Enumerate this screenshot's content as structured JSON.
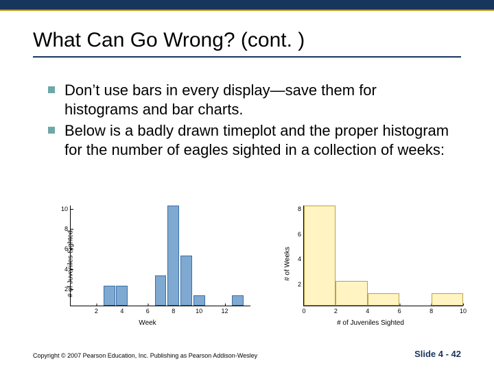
{
  "title": "What Can Go Wrong? (cont. )",
  "bullets": [
    "Don’t use bars in every display—save them for histograms and bar charts.",
    "Below is a badly drawn timeplot and the proper histogram for the number of eagles sighted in a collection of weeks:"
  ],
  "footer": {
    "copyright": "Copyright © 2007 Pearson Education, Inc. Publishing as Pearson Addison-Wesley",
    "slide": "Slide 4 - 42"
  },
  "chart_data": [
    {
      "type": "bar",
      "title": "",
      "xlabel": "Week",
      "ylabel": "# of Juveniles Sighted",
      "ylim": [
        0,
        10
      ],
      "yticks": [
        2,
        4,
        6,
        8,
        10
      ],
      "xticks": [
        2,
        4,
        6,
        8,
        10,
        12
      ],
      "x": [
        3,
        4,
        7,
        8,
        9,
        10,
        13
      ],
      "values": [
        2,
        2,
        3,
        10,
        5,
        1,
        1
      ],
      "bar_color": "#7fa9d0",
      "note": "badly drawn timeplot rendered as bars"
    },
    {
      "type": "bar",
      "title": "",
      "xlabel": "# of Juveniles Sighted",
      "ylabel": "# of Weeks",
      "ylim": [
        0,
        8
      ],
      "yticks": [
        2,
        4,
        6,
        8
      ],
      "xticks": [
        0,
        2,
        4,
        6,
        8,
        10
      ],
      "categories": [
        0,
        2,
        4,
        6,
        8
      ],
      "values": [
        8,
        2,
        1,
        0,
        1
      ],
      "bar_color": "#fff4c2"
    }
  ]
}
